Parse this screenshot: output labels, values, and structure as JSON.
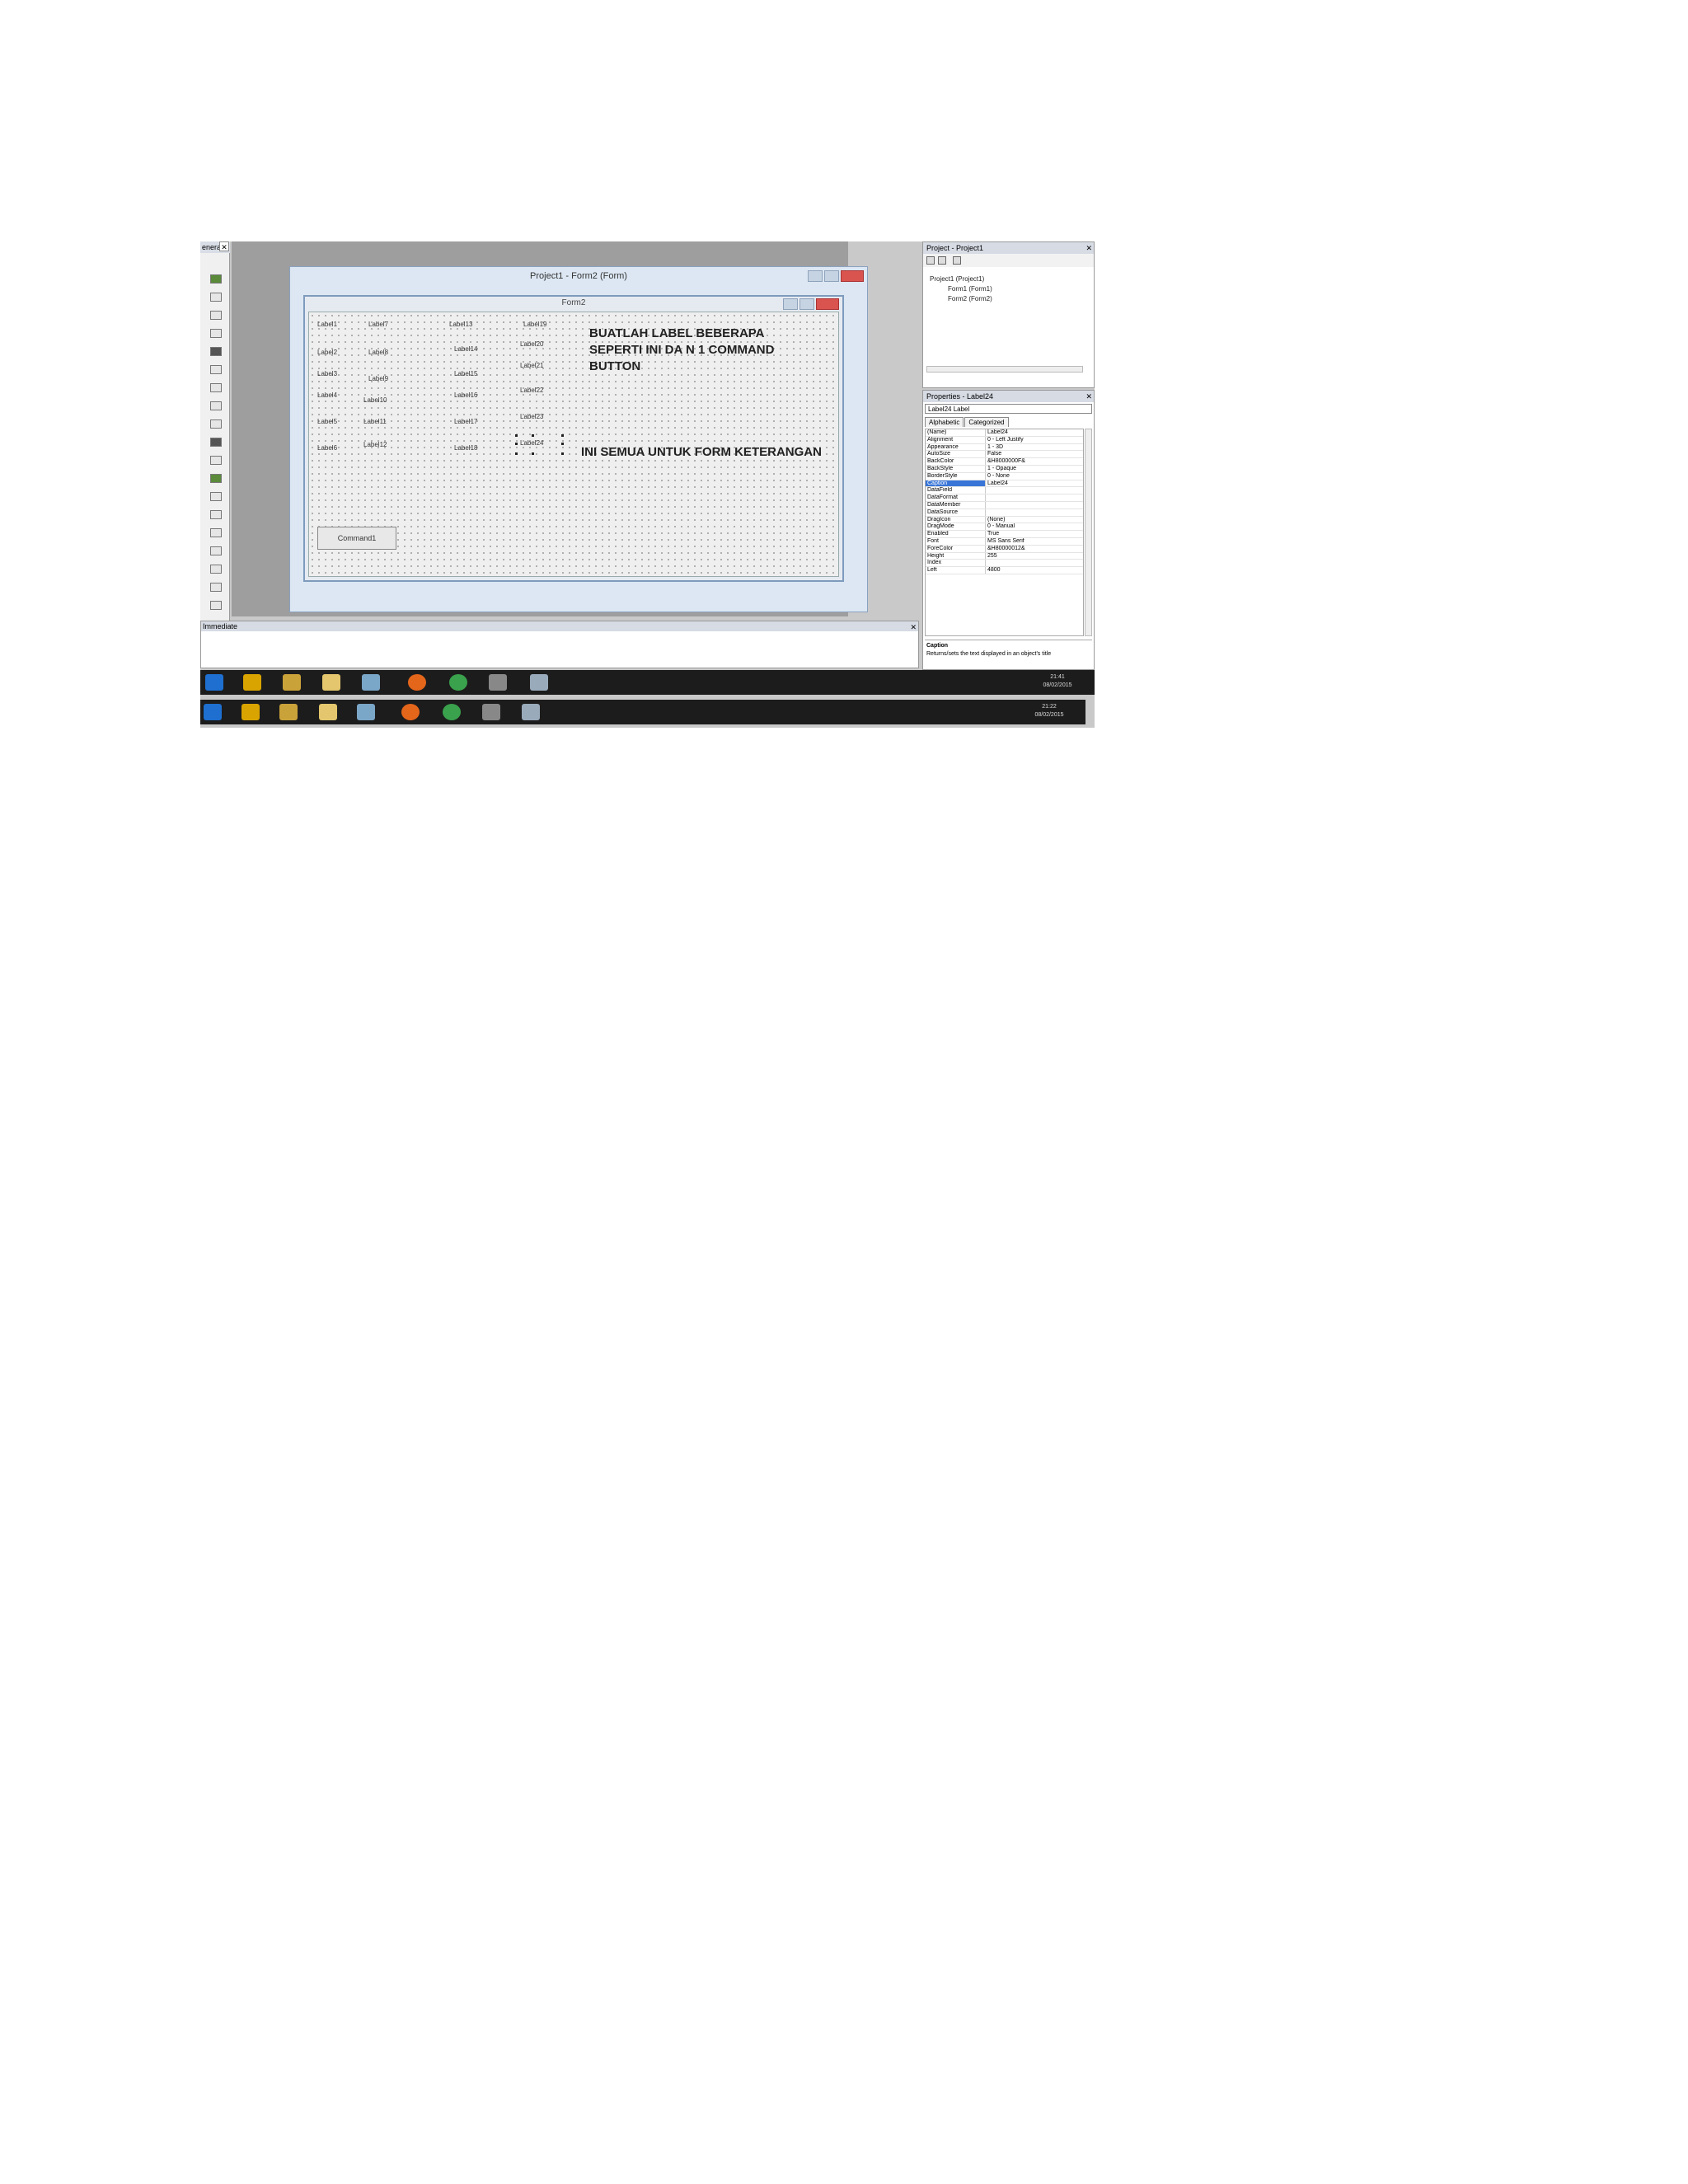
{
  "toolbox": {
    "header": "eneral",
    "close": "✕"
  },
  "project_window": {
    "title": "Project1 - Form2 (Form)"
  },
  "form": {
    "title": "Form2",
    "labels": [
      "Label1",
      "Label7",
      "Label13",
      "Label19",
      "Label2",
      "Label8",
      "Label14",
      "Label20",
      "Label3",
      "Label9",
      "Label15",
      "Label21",
      "Label4",
      "Label10",
      "Label16",
      "Label22",
      "Label5",
      "Label11",
      "Label17",
      "Label23",
      "Label6",
      "Label12",
      "Label18",
      "Label24"
    ],
    "note1_lines": [
      "BUATLAH LABEL BEBERAPA",
      "SEPERTI INI DA N 1 COMMAND",
      "BUTTON"
    ],
    "note2": "INI SEMUA UNTUK FORM KETERANGAN",
    "button": "Command1"
  },
  "project_explorer": {
    "title": "Project - Project1",
    "close": "✕",
    "tree": [
      "Project1 (Project1)",
      "Form1 (Form1)",
      "Form2 (Form2)"
    ]
  },
  "properties": {
    "title": "Properties - Label24",
    "close": "✕",
    "object": "Label24 Label",
    "tabs": [
      "Alphabetic",
      "Categorized"
    ],
    "rows": [
      {
        "name": "(Name)",
        "value": "Label24"
      },
      {
        "name": "Alignment",
        "value": "0 - Left Justify"
      },
      {
        "name": "Appearance",
        "value": "1 - 3D"
      },
      {
        "name": "AutoSize",
        "value": "False"
      },
      {
        "name": "BackColor",
        "value": "&H8000000F&"
      },
      {
        "name": "BackStyle",
        "value": "1 - Opaque"
      },
      {
        "name": "BorderStyle",
        "value": "0 - None"
      },
      {
        "name": "Caption",
        "value": "Label24",
        "selected": true
      },
      {
        "name": "DataField",
        "value": ""
      },
      {
        "name": "DataFormat",
        "value": ""
      },
      {
        "name": "DataMember",
        "value": ""
      },
      {
        "name": "DataSource",
        "value": ""
      },
      {
        "name": "DragIcon",
        "value": "(None)"
      },
      {
        "name": "DragMode",
        "value": "0 - Manual"
      },
      {
        "name": "Enabled",
        "value": "True"
      },
      {
        "name": "Font",
        "value": "MS Sans Serif"
      },
      {
        "name": "ForeColor",
        "value": "&H80000012&"
      },
      {
        "name": "Height",
        "value": "255"
      },
      {
        "name": "Index",
        "value": ""
      },
      {
        "name": "Left",
        "value": "4800"
      }
    ],
    "desc_title": "Caption",
    "desc_text": "Returns/sets the text displayed in an object's title"
  },
  "immediate": {
    "title": "Immediate",
    "close": "✕"
  },
  "taskbar1": {
    "time": "21:41",
    "date": "08/02/2015"
  },
  "taskbar2": {
    "time": "21:22",
    "date": "08/02/2015"
  },
  "icons": [
    "ie-icon",
    "media-icon",
    "tools-icon",
    "folder-icon",
    "app-icon",
    "firefox-icon",
    "chrome-icon",
    "vb-icon",
    "paint-icon"
  ]
}
